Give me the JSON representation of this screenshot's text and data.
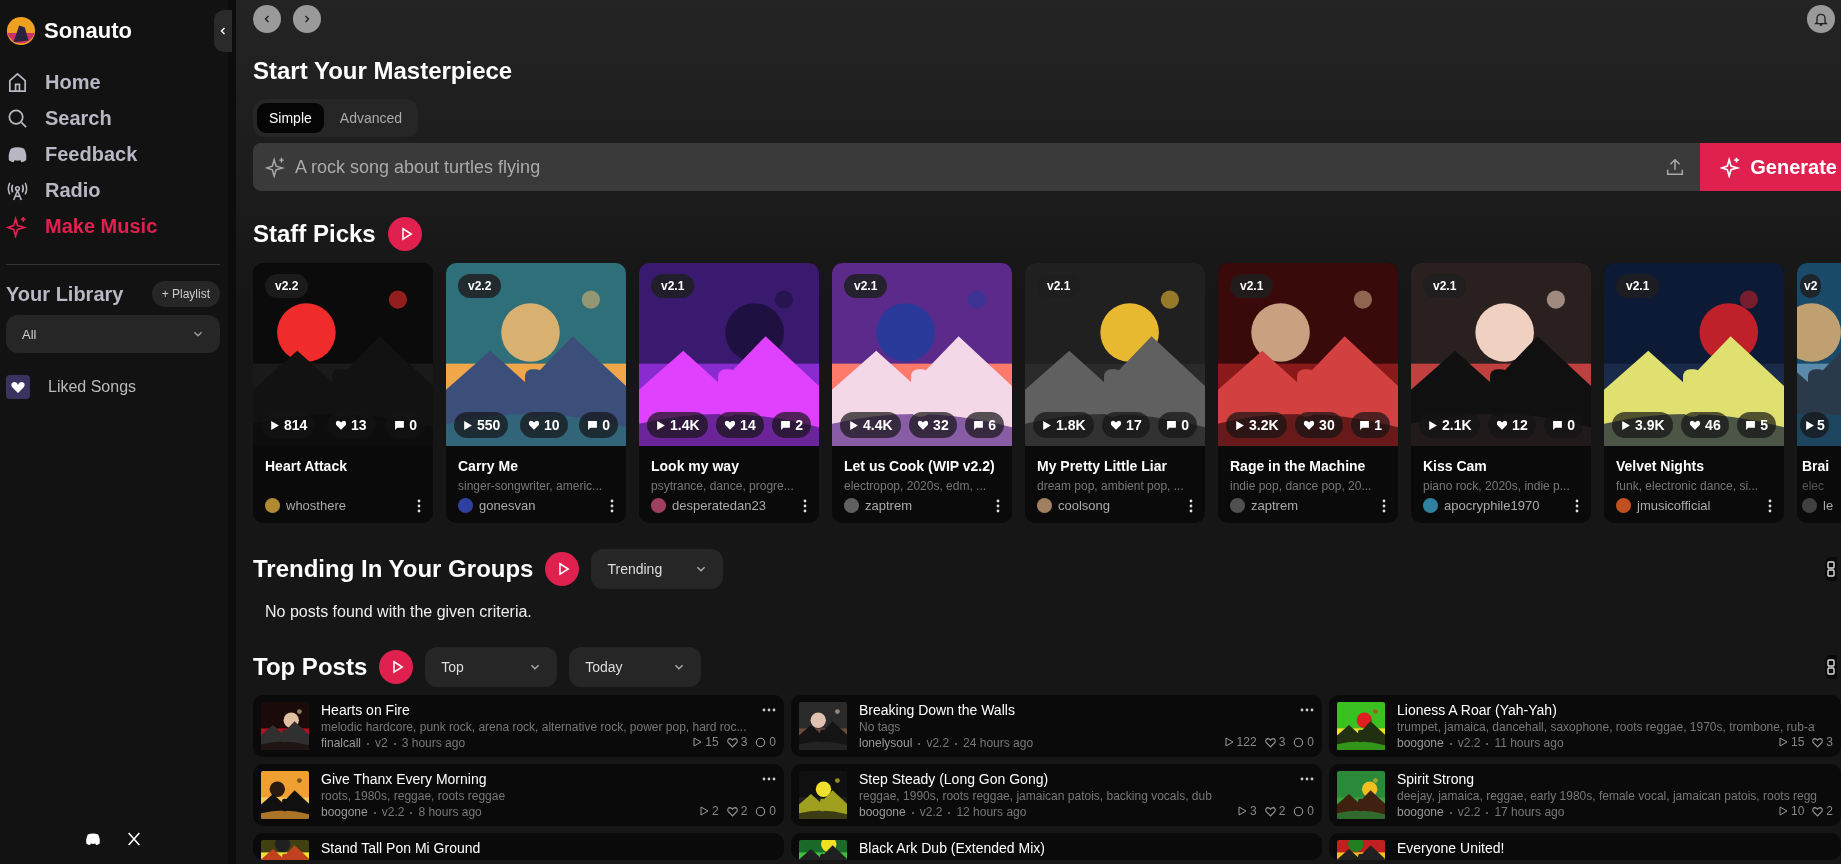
{
  "brand": {
    "name": "Sonauto"
  },
  "nav": [
    {
      "label": "Home",
      "selected": false
    },
    {
      "label": "Search",
      "selected": false
    },
    {
      "label": "Feedback",
      "selected": false
    },
    {
      "label": "Radio",
      "selected": false
    },
    {
      "label": "Make Music",
      "selected": true
    }
  ],
  "library": {
    "title": "Your Library",
    "add_button": "+ Playlist",
    "filter": "All",
    "items": [
      {
        "label": "Liked Songs"
      }
    ]
  },
  "create": {
    "title": "Start Your Masterpiece",
    "tabs": [
      {
        "label": "Simple",
        "selected": true
      },
      {
        "label": "Advanced",
        "selected": false
      }
    ],
    "prompt": {
      "placeholder": "A rock song about turtles flying"
    },
    "generate_button": "Generate"
  },
  "staff_picks": {
    "title": "Staff Picks",
    "cards": [
      {
        "title": "Heart Attack",
        "version": "v2.2",
        "plays": "814",
        "likes": "13",
        "comments": "0",
        "author": "whosthere"
      },
      {
        "title": "Carry Me",
        "tags": "singer-songwriter, americ...",
        "version": "v2.2",
        "plays": "550",
        "likes": "10",
        "comments": "0",
        "author": "gonesvan"
      },
      {
        "title": "Look my way",
        "tags": "psytrance, dance, progre...",
        "version": "v2.1",
        "plays": "1.4K",
        "likes": "14",
        "comments": "2",
        "author": "desperatedan23"
      },
      {
        "title": "Let us Cook (WIP v2.2)",
        "tags": "electropop, 2020s, edm, ...",
        "version": "v2.1",
        "plays": "4.4K",
        "likes": "32",
        "comments": "6",
        "author": "zaptrem"
      },
      {
        "title": "My Pretty Little Liar",
        "tags": "dream pop, ambient pop, ...",
        "version": "v2.1",
        "plays": "1.8K",
        "likes": "17",
        "comments": "0",
        "author": "coolsong"
      },
      {
        "title": "Rage in the Machine",
        "tags": "indie pop, dance pop, 20...",
        "version": "v2.1",
        "plays": "3.2K",
        "likes": "30",
        "comments": "1",
        "author": "zaptrem"
      },
      {
        "title": "Kiss Cam",
        "tags": "piano rock, 2020s, indie p...",
        "version": "v2.1",
        "plays": "2.1K",
        "likes": "12",
        "comments": "0",
        "author": "apocryphile1970"
      },
      {
        "title": "Velvet Nights",
        "tags": "funk, electronic dance, si...",
        "version": "v2.1",
        "plays": "3.9K",
        "likes": "46",
        "comments": "5",
        "author": "jmusicofficial"
      },
      {
        "title": "Brai",
        "tags": "elec",
        "version": "v2",
        "plays": "5",
        "author": "le"
      }
    ]
  },
  "trending": {
    "title": "Trending In Your Groups",
    "sort": "Trending",
    "empty_message": "No posts found with the given criteria."
  },
  "top_posts": {
    "title": "Top Posts",
    "sort": "Top",
    "period": "Today",
    "posts": [
      {
        "title": "Hearts on Fire",
        "tags": "melodic hardcore, punk rock, arena rock, alternative rock, power pop, hard roc...",
        "author": "finalcall",
        "version": "v2",
        "time": "3 hours ago",
        "plays": "15",
        "likes": "3",
        "comments": "0"
      },
      {
        "title": "Breaking Down the Walls",
        "tags": "No tags",
        "author": "lonelysoul",
        "version": "v2.2",
        "time": "24 hours ago",
        "plays": "122",
        "likes": "3",
        "comments": "0"
      },
      {
        "title": "Lioness A Roar (Yah-Yah)",
        "tags": "trumpet, jamaica, dancehall, saxophone, roots reggae, 1970s, trombone, rub-a",
        "author": "boogone",
        "version": "v2.2",
        "time": "11 hours ago",
        "plays": "15",
        "likes": "3"
      },
      {
        "title": "Give Thanx Every Morning",
        "tags": "roots, 1980s, reggae, roots reggae",
        "author": "boogone",
        "version": "v2.2",
        "time": "8 hours ago",
        "plays": "2",
        "likes": "2",
        "comments": "0"
      },
      {
        "title": "Step Steady (Long Gon Gong)",
        "tags": "reggae, 1990s, roots reggae, jamaican patois, backing vocals, dub",
        "author": "boogone",
        "version": "v2.2",
        "time": "12 hours ago",
        "plays": "3",
        "likes": "2",
        "comments": "0"
      },
      {
        "title": "Spirit Strong",
        "tags": "deejay, jamaica, reggae, early 1980s, female vocal, jamaican patois, roots regg",
        "author": "boogone",
        "version": "v2.2",
        "time": "17 hours ago",
        "plays": "10",
        "likes": "2"
      },
      {
        "title": "Stand Tall Pon Mi Ground"
      },
      {
        "title": "Black Ark Dub (Extended Mix)"
      },
      {
        "title": "Everyone United!"
      }
    ]
  }
}
